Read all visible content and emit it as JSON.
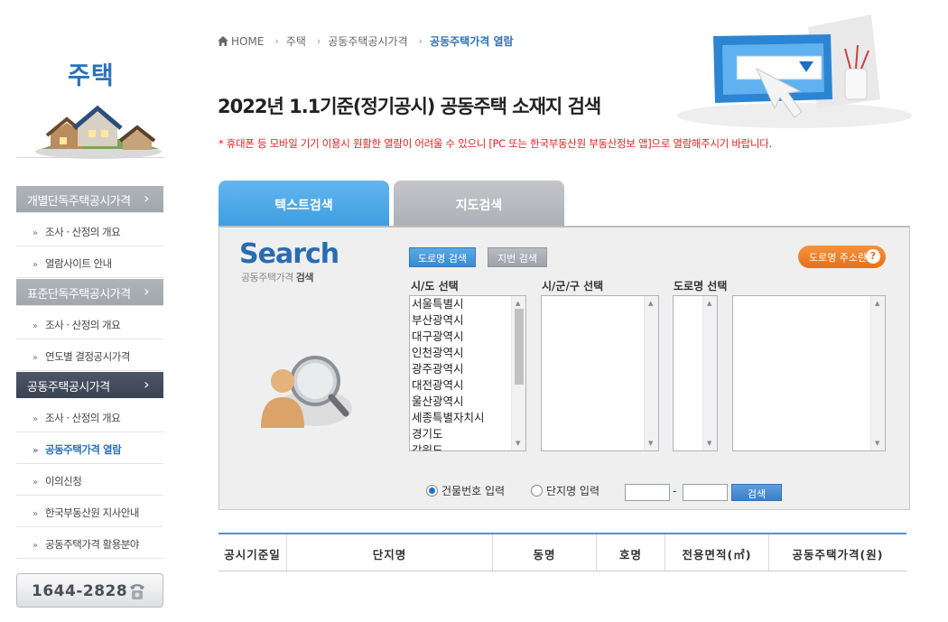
{
  "sidebar": {
    "title": "주택",
    "categories": [
      {
        "label": "개별단독주택공시가격",
        "chevron": "›"
      },
      {
        "label": "표준단독주택공시가격",
        "chevron": "›"
      },
      {
        "label": "공동주택공시가격",
        "chevron": "›"
      }
    ],
    "items": [
      "조사 · 산정의 개요",
      "열람사이트 안내",
      "조사 · 산정의 개요",
      "연도별 결정공시가격",
      "조사 · 산정의 개요",
      "공동주택가격 열람",
      "이의신청",
      "한국부동산원 지사안내",
      "공동주택가격 활용분야"
    ],
    "bullet": "»",
    "phone": "1644-2828"
  },
  "breadcrumb": {
    "home": "HOME",
    "sep": "›",
    "items": [
      "주택",
      "공동주택공시가격",
      "공동주택가격 열람"
    ]
  },
  "page": {
    "title": "2022년 1.1기준(정기공시) 공동주택 소재지 검색",
    "notice": "* 휴대폰 등 모바일 기기 이용시 원활한 열람이 어려울 수 있으니 [PC 또는 한국부동산원 부동산정보 앱]으로 열람해주시기 바랍니다."
  },
  "tabs": {
    "text_search": "텍스트검색",
    "map_search": "지도검색"
  },
  "search": {
    "logo": "Search",
    "subtitle_prefix": "공동주택가격",
    "subtitle_bold": "검색",
    "road_button": "도로명 검색",
    "lot_button": "지번 검색",
    "help_button": "도로명 주소란",
    "help_icon": "?",
    "labels": {
      "sido": "시/도 선택",
      "sigungu": "시/군/구 선택",
      "road": "도로명 선택"
    },
    "sido_options": [
      "서울특별시",
      "부산광역시",
      "대구광역시",
      "인천광역시",
      "광주광역시",
      "대전광역시",
      "울산광역시",
      "세종특별자치시",
      "경기도",
      "강원도"
    ],
    "radio_building": "건물번호 입력",
    "radio_complex": "단지명 입력",
    "dash": "-",
    "search_button": "검색"
  },
  "table": {
    "headers": [
      "공시기준일",
      "단지명",
      "동명",
      "호명",
      "전용면적(㎡)",
      "공동주택가격(원)"
    ]
  },
  "colors": {
    "accent": "#2a72b9",
    "notice": "#dd2222",
    "tab_active": "#3f9ee1",
    "help_orange": "#e5701b"
  }
}
